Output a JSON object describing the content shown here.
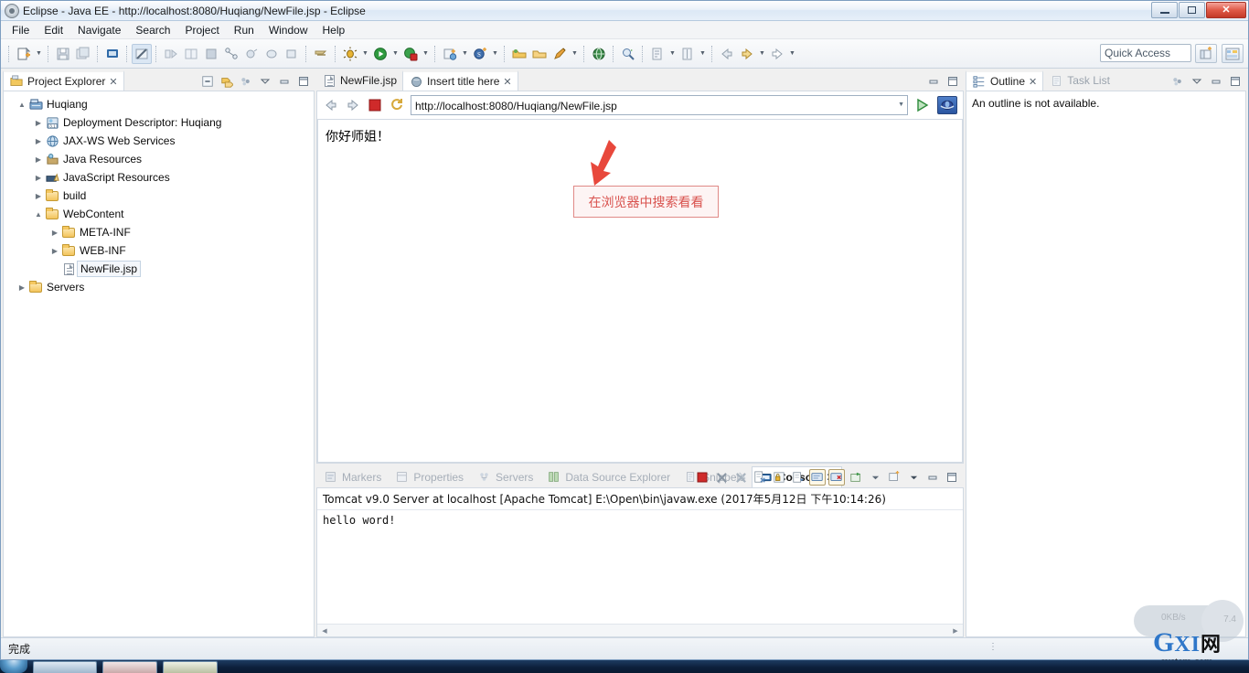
{
  "window": {
    "title": "Eclipse - Java EE - http://localhost:8080/Huqiang/NewFile.jsp - Eclipse",
    "app_icon": "eclipse-icon",
    "minimize_label": "Minimize",
    "restore_label": "Restore",
    "close_label": "Close"
  },
  "menu": {
    "items": [
      {
        "label": "File",
        "mnemonic": "F"
      },
      {
        "label": "Edit",
        "mnemonic": "E"
      },
      {
        "label": "Navigate",
        "mnemonic": "N"
      },
      {
        "label": "Search",
        "mnemonic": "a"
      },
      {
        "label": "Project",
        "mnemonic": "P"
      },
      {
        "label": "Run",
        "mnemonic": "R"
      },
      {
        "label": "Window",
        "mnemonic": "W"
      },
      {
        "label": "Help",
        "mnemonic": "H"
      }
    ]
  },
  "toolbar": {
    "quick_access_placeholder": "Quick Access",
    "quick_access_value": "",
    "icons": [
      "new-wizard-icon",
      "new-dropdown-arrow",
      "save-icon",
      "save-all-icon",
      "print-icon",
      "toggle-mark-occurrences-icon",
      "next-annotation-icon",
      "previous-annotation-icon",
      "last-edit-icon",
      "link-with-editor-icon",
      "new-java-package-icon",
      "new-class-icon",
      "new-project-icon",
      "externalize-strings-icon",
      "debug-icon",
      "debug-dropdown-arrow",
      "run-icon",
      "run-dropdown-arrow",
      "run-server-icon",
      "run-server-dropdown-arrow",
      "new-ejb-icon",
      "new-ejb-dropdown-arrow",
      "new-server-icon",
      "new-server-dropdown-arrow",
      "open-type-icon",
      "open-task-icon",
      "open-resource-icon",
      "open-dropdown-arrow",
      "web-browser-icon",
      "search-icon",
      "next-edit-icon",
      "next-edit-dropdown-arrow",
      "previous-edit-icon",
      "previous-edit-dropdown-arrow",
      "back-icon",
      "forward-icon",
      "forward-dropdown-arrow",
      "next-icon",
      "next-dropdown-arrow"
    ],
    "perspective_buttons": [
      "open-perspective-icon",
      "java-ee-perspective-icon"
    ]
  },
  "project_explorer": {
    "tab_label": "Project Explorer",
    "tab_icon": "project-explorer-icon",
    "close_icon": "close-icon",
    "toolbar_icons": [
      "collapse-all-icon",
      "link-with-editor-icon",
      "view-menu-icon",
      "minimize-icon",
      "maximize-icon"
    ],
    "tree": [
      {
        "label": "Huqiang",
        "icon": "project-icon",
        "indent": 0,
        "twisty": "expanded",
        "selected": false
      },
      {
        "label": "Deployment Descriptor: Huqiang",
        "icon": "deployment-descriptor-icon",
        "indent": 1,
        "twisty": "collapsed",
        "selected": false
      },
      {
        "label": "JAX-WS Web Services",
        "icon": "web-services-icon",
        "indent": 1,
        "twisty": "collapsed",
        "selected": false
      },
      {
        "label": "Java Resources",
        "icon": "java-resources-icon",
        "indent": 1,
        "twisty": "collapsed",
        "selected": false
      },
      {
        "label": "JavaScript Resources",
        "icon": "javascript-resources-icon",
        "indent": 1,
        "twisty": "collapsed",
        "selected": false
      },
      {
        "label": "build",
        "icon": "folder-icon",
        "indent": 1,
        "twisty": "collapsed",
        "selected": false
      },
      {
        "label": "WebContent",
        "icon": "folder-icon",
        "indent": 1,
        "twisty": "expanded",
        "selected": false
      },
      {
        "label": "META-INF",
        "icon": "folder-icon",
        "indent": 2,
        "twisty": "collapsed",
        "selected": false
      },
      {
        "label": "WEB-INF",
        "icon": "folder-icon",
        "indent": 2,
        "twisty": "collapsed",
        "selected": false
      },
      {
        "label": "NewFile.jsp",
        "icon": "jsp-file-icon",
        "indent": 2,
        "twisty": "none",
        "selected": true
      },
      {
        "label": "Servers",
        "icon": "folder-icon",
        "indent": 0,
        "twisty": "collapsed",
        "selected": false
      }
    ]
  },
  "editor": {
    "tabs": [
      {
        "label": "NewFile.jsp",
        "icon": "jsp-file-icon",
        "active": false,
        "closable": false
      },
      {
        "label": "Insert title here",
        "icon": "web-browser-icon",
        "active": true,
        "closable": true
      }
    ],
    "minimize_icon": "minimize-icon",
    "maximize_icon": "maximize-icon",
    "browser": {
      "back_icon": "back-arrow-icon",
      "forward_icon": "forward-arrow-icon",
      "stop_icon": "stop-icon",
      "refresh_icon": "refresh-icon",
      "url_value": "http://localhost:8080/Huqiang/NewFile.jsp",
      "url_dropdown_icon": "chevron-down-icon",
      "go_icon": "go-icon",
      "open-external-icon": "open-in-external-browser-icon",
      "page_content": "你好师姐！"
    },
    "annotation": {
      "text": "在浏览器中搜索看看",
      "color": "#d9534f"
    }
  },
  "outline": {
    "tabs": [
      {
        "label": "Outline",
        "icon": "outline-icon",
        "active": true,
        "closable": true
      },
      {
        "label": "Task List",
        "icon": "task-list-icon",
        "active": false,
        "closable": false
      }
    ],
    "toolbar_icons": [
      "view-menu-icon",
      "minimize-icon",
      "maximize-icon"
    ],
    "message": "An outline is not available."
  },
  "bottom_panel": {
    "tabs": [
      {
        "label": "Markers",
        "icon": "markers-icon",
        "active": false,
        "closable": false
      },
      {
        "label": "Properties",
        "icon": "properties-icon",
        "active": false,
        "closable": false
      },
      {
        "label": "Servers",
        "icon": "servers-icon",
        "active": false,
        "closable": false
      },
      {
        "label": "Data Source Explorer",
        "icon": "data-source-explorer-icon",
        "active": false,
        "closable": false
      },
      {
        "label": "Snippets",
        "icon": "snippets-icon",
        "active": false,
        "closable": false
      },
      {
        "label": "Console",
        "icon": "console-icon",
        "active": true,
        "closable": true
      }
    ],
    "toolbar_icons": [
      "terminate-icon",
      "remove-launch-icon",
      "remove-all-terminated-icon",
      "clear-console-icon",
      "scroll-lock-icon",
      "show-console-on-output-icon",
      "pin-console-icon",
      "display-selected-console-icon",
      "open-console-icon",
      "open-console-dropdown-arrow",
      "new-console-view-icon",
      "new-console-dropdown-arrow",
      "minimize-icon",
      "maximize-icon"
    ],
    "console": {
      "header": "Tomcat v9.0 Server at localhost [Apache Tomcat] E:\\Open\\bin\\javaw.exe (2017年5月12日 下午10:14:26)",
      "output": "hello word!"
    }
  },
  "statusbar": {
    "text": "完成"
  },
  "watermark": {
    "g": "G",
    "xi": "XI",
    "cn": "网",
    "domain": "system.com"
  },
  "float_widget": {
    "left_text": "0KB/s",
    "right_text": "7.4"
  }
}
